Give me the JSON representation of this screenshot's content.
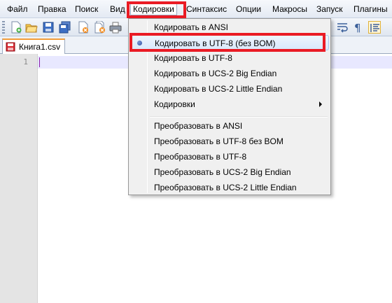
{
  "menubar": {
    "items": [
      "Файл",
      "Правка",
      "Поиск",
      "Вид",
      "Кодировки",
      "Синтаксис",
      "Опции",
      "Макросы",
      "Запуск",
      "Плагины"
    ],
    "active": "Кодировки"
  },
  "toolbar": {
    "buttons": [
      "new-file-icon",
      "open-file-icon",
      "save-icon",
      "save-all-icon",
      "close-icon",
      "close-all-icon",
      "print-icon",
      "word-wrap-icon",
      "show-all-characters-icon",
      "indent-guide-icon"
    ]
  },
  "tabs": [
    {
      "label": "Книга1.csv",
      "icon": "file-unsaved-icon"
    }
  ],
  "editor": {
    "line_numbers": [
      "1"
    ]
  },
  "encoding_menu": {
    "items": [
      {
        "label": "Кодировать в ANSI",
        "checked": false,
        "submenu": false
      },
      {
        "label": "Кодировать в UTF-8 (без BOM)",
        "checked": true,
        "submenu": false
      },
      {
        "label": "Кодировать в UTF-8",
        "checked": false,
        "submenu": false
      },
      {
        "label": "Кодировать в UCS-2 Big Endian",
        "checked": false,
        "submenu": false
      },
      {
        "label": "Кодировать в UCS-2 Little Endian",
        "checked": false,
        "submenu": false
      },
      {
        "label": "Кодировки",
        "checked": false,
        "submenu": true
      },
      {
        "label": "Преобразовать в ANSI",
        "checked": false,
        "submenu": false
      },
      {
        "label": "Преобразовать в UTF-8 без BOM",
        "checked": false,
        "submenu": false
      },
      {
        "label": "Преобразовать в UTF-8",
        "checked": false,
        "submenu": false
      },
      {
        "label": "Преобразовать в UCS-2 Big Endian",
        "checked": false,
        "submenu": false
      },
      {
        "label": "Преобразовать в UCS-2 Little Endian",
        "checked": false,
        "submenu": false
      }
    ]
  },
  "colors": {
    "highlight": "#ea1b24",
    "current_line": "#e8e8ff",
    "gutter": "#e4e4e4"
  }
}
